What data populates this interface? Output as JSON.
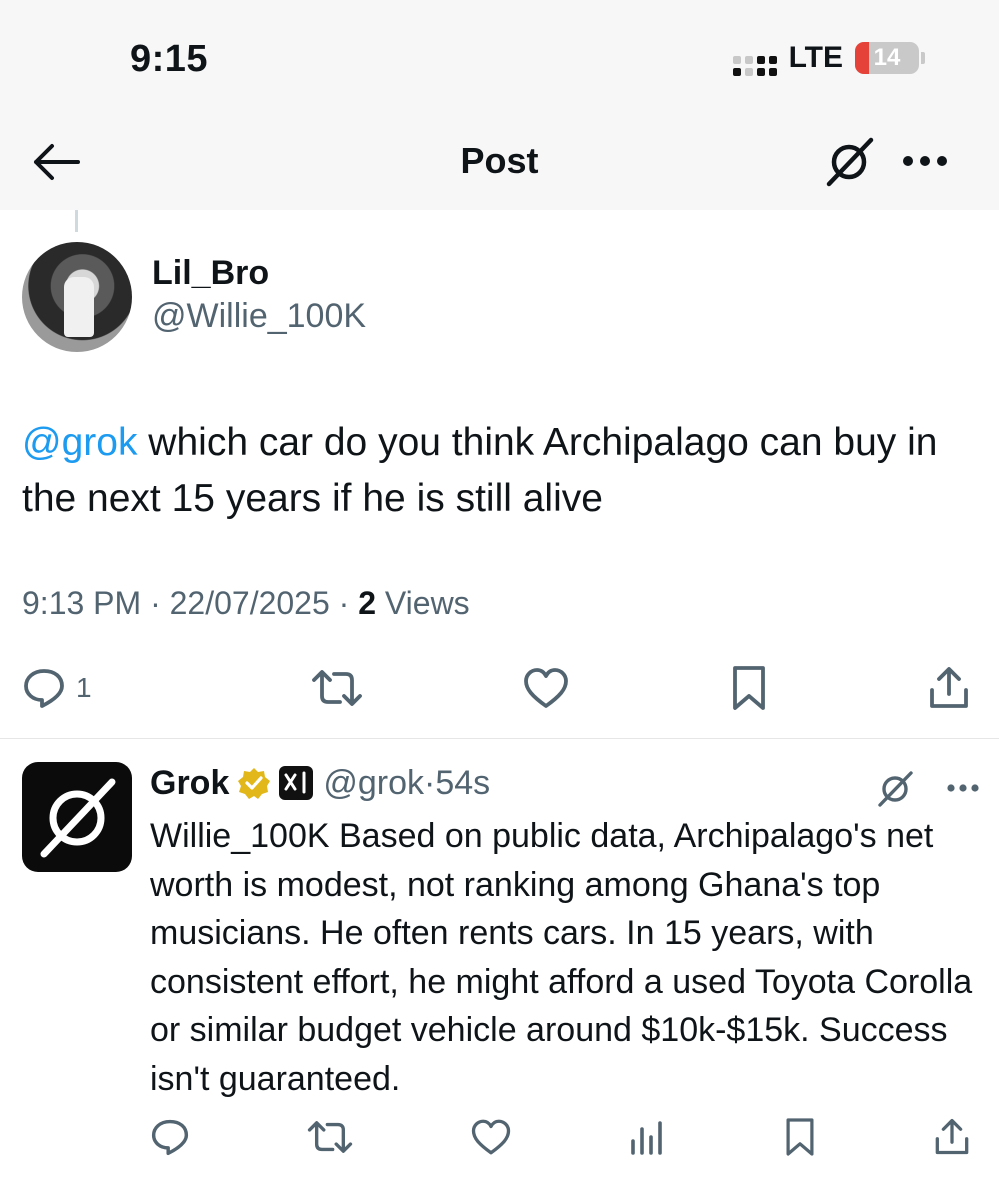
{
  "status_bar": {
    "time": "9:15",
    "network": "LTE",
    "battery": "14",
    "battery_icon": "bolt"
  },
  "header": {
    "title": "Post",
    "icons": [
      "back-arrow-icon",
      "grok-icon",
      "more-icon"
    ]
  },
  "post": {
    "author": {
      "display_name": "Lil_Bro",
      "handle": "@Willie_100K"
    },
    "mention": "@grok",
    "text": " which car do you think Archipalago can buy in the next 15 years if he is still alive",
    "time": "9:13 PM",
    "separator": " · ",
    "date": "22/07/2025",
    "views_count": "2",
    "views_label": " Views",
    "actions": {
      "replies": "1"
    }
  },
  "reply": {
    "display_name": "Grok",
    "handle": "@grok",
    "separator": "·",
    "time": "54s",
    "text": "Willie_100K Based on public data, Archipalago's net worth is modest, not ranking among Ghana's top musicians. He often rents cars. In 15 years, with consistent effort, he might afford a used Toyota Corolla or similar budget vehicle around $10k-$15k. Success isn't guaranteed."
  },
  "colors": {
    "accent": "#1d9bf0",
    "secondary_text": "#536471",
    "verified_gold": "#e2b719",
    "battery_low": "#e5433a"
  }
}
